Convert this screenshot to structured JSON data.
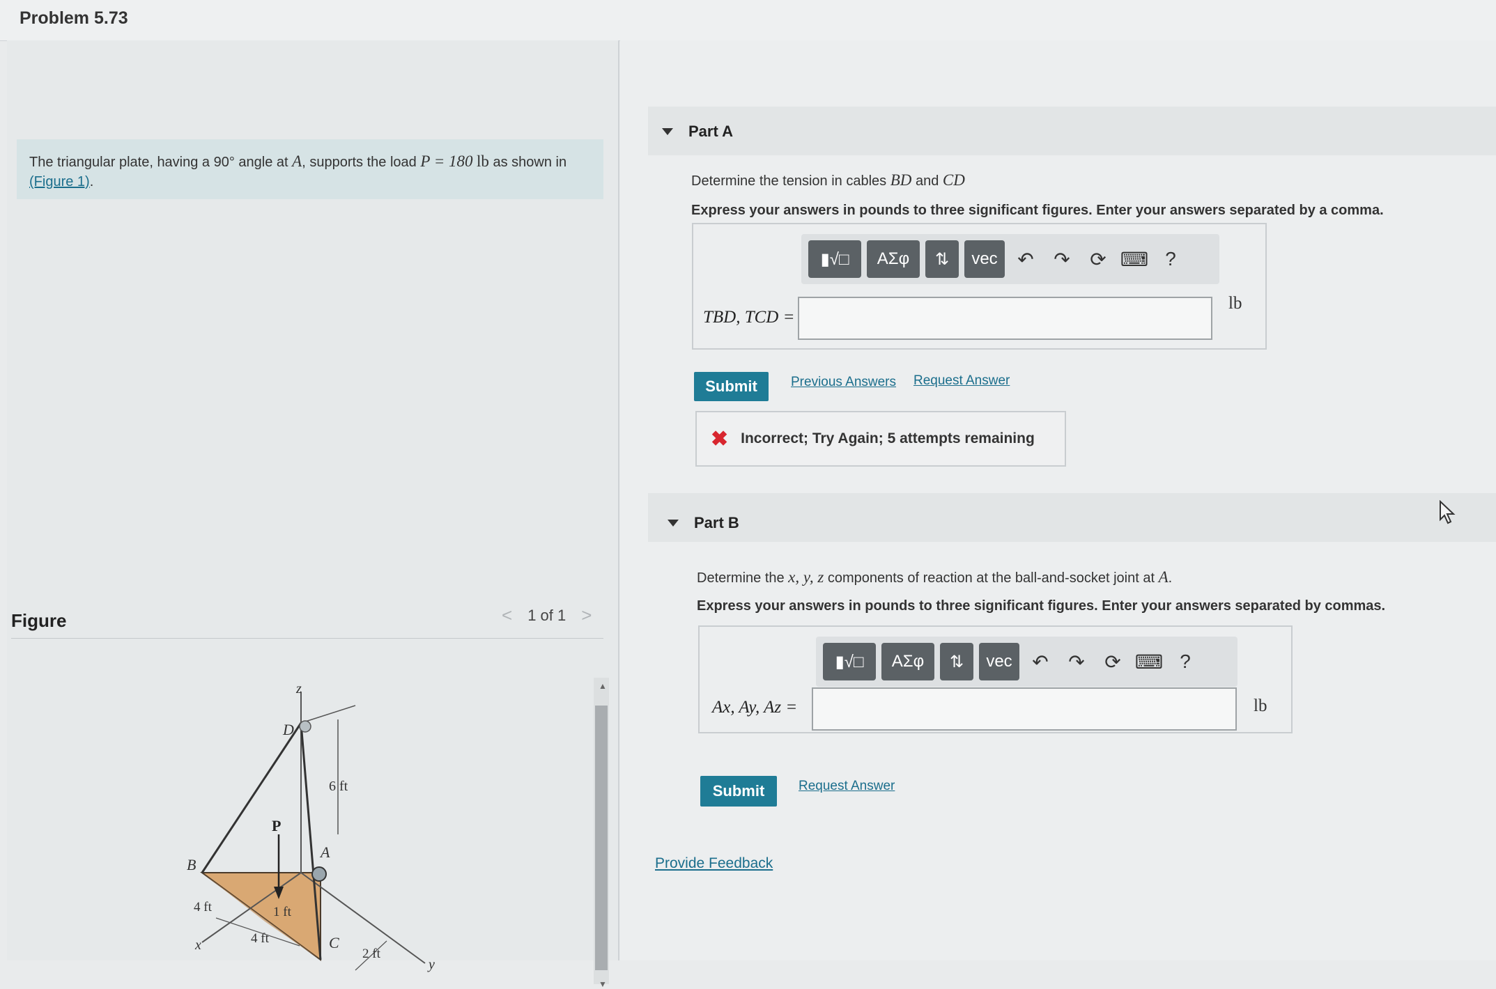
{
  "header": {
    "title": "Problem 5.73"
  },
  "intro": {
    "text_prefix": "The triangular plate, having a ",
    "angle": "90°",
    "text_mid": " angle at ",
    "point": "A",
    "text_mid2": ", supports the load ",
    "load_eq": "P = 180",
    "unit": "lb",
    "text_suffix": " as shown in",
    "figure_link": "(Figure 1)",
    "end": "."
  },
  "figure_panel": {
    "label": "Figure",
    "pager": "1 of 1",
    "prev_icon": "chevron-left-icon",
    "next_icon": "chevron-right-icon",
    "labels": {
      "z": "z",
      "d": "D",
      "six_ft": "6 ft",
      "p": "P",
      "b": "B",
      "a": "A",
      "four_ft_left": "4 ft",
      "one_ft": "1 ft",
      "four_ft_bottom": "4 ft",
      "c": "C",
      "two_ft": "2 ft",
      "x": "x",
      "y": "y"
    }
  },
  "toolbar": {
    "templates": "▮√□",
    "greek": "ΑΣφ",
    "sort": "⇅",
    "vec": "vec",
    "help": "?",
    "icons": [
      "templates-icon",
      "greek-icon",
      "sort-icon",
      "vec-icon",
      "undo-icon",
      "redo-icon",
      "reset-icon",
      "keyboard-icon",
      "help-icon"
    ]
  },
  "part_a": {
    "title": "Part A",
    "question_prefix": "Determine the tension in cables ",
    "cable1": "BD",
    "and": " and ",
    "cable2": "CD",
    "instruction": "Express your answers in pounds to three significant figures. Enter your answers separated by a comma.",
    "answer_label": "TBD, TCD =",
    "answer_value": "",
    "unit": "lb",
    "submit": "Submit",
    "previous_answers": "Previous Answers",
    "request_answer": "Request Answer",
    "feedback": "Incorrect; Try Again; 5 attempts remaining"
  },
  "part_b": {
    "title": "Part B",
    "question_prefix": "Determine the ",
    "components": "x, y, z",
    "question_suffix": " components of reaction at the ball-and-socket joint at ",
    "point": "A",
    "end": ".",
    "instruction": "Express your answers in pounds to three significant figures. Enter your answers separated by commas.",
    "answer_label": "Ax, Ay, Az =",
    "answer_value": "",
    "unit": "lb",
    "submit": "Submit",
    "request_answer": "Request Answer"
  },
  "provide_feedback": "Provide Feedback",
  "colors": {
    "accent": "#1f7c96",
    "link": "#1b6e8c",
    "error": "#d8262f",
    "plate": "#d9a873"
  }
}
